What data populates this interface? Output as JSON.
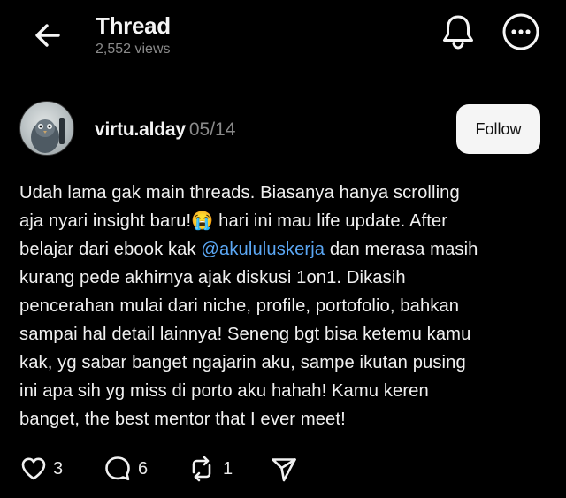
{
  "header": {
    "title": "Thread",
    "views": "2,552 views",
    "icons": {
      "back": "arrow-left-icon",
      "bell": "bell-icon",
      "more": "more-horizontal-icon"
    }
  },
  "post": {
    "author": {
      "username": "virtu.alday",
      "date": "05/14",
      "follow_label": "Follow"
    },
    "body": {
      "part1": "Udah lama gak main threads. Biasanya hanya scrolling\naja nyari insight baru!😭 hari ini mau life update. After\nbelajar dari ebook kak ",
      "mention": "@akululuskerja",
      "part2": " dan merasa masih\nkurang pede akhirnya ajak diskusi 1on1. Dikasih\npencerahan mulai dari niche, profile, portofolio, bahkan\nsampai hal detail lainnya! Seneng bgt bisa ketemu kamu\nkak, yg sabar banget ngajarin aku, sampe ikutan pusing\nini apa sih yg miss di porto aku hahah! Kamu keren\nbanget, the best mentor that I ever meet!"
    },
    "actions": {
      "likes": "3",
      "replies": "6",
      "reposts": "1"
    }
  },
  "colors": {
    "background": "#000000",
    "text": "#f3f3f3",
    "muted": "#8a8a8a",
    "mention": "#5ba7f4",
    "follow_bg": "#f5f5f5"
  }
}
